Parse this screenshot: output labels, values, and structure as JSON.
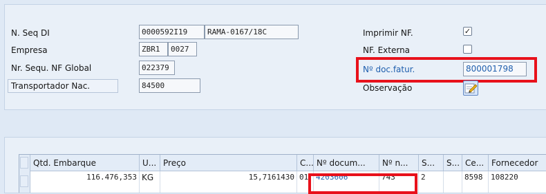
{
  "header_form": {
    "seq_di_label": "N. Seq DI",
    "seq_di_value": "0000592I19",
    "seq_di_ref": "RAMA-0167/18C",
    "empresa_label": "Empresa",
    "empresa_value1": "ZBR1",
    "empresa_value2": "0027",
    "nf_global_label": "Nr. Sequ. NF Global",
    "nf_global_value": "022379",
    "transportador_label": "Transportador Nac.",
    "transportador_value": "84500",
    "imprimir_nf_label": "Imprimir NF.",
    "imprimir_nf_checked": "✓",
    "nf_externa_label": "NF. Externa",
    "nf_externa_checked": "",
    "doc_fatur_label": "Nº doc.fatur.",
    "doc_fatur_value": "800001798",
    "observacao_label": "Observação",
    "observacao_icon": "edit-note-icon"
  },
  "table": {
    "columns": [
      "Qtd. Embarque",
      "U...",
      "Preço",
      "C...",
      "Nº docum...",
      "Nº n...",
      "S...",
      "S...",
      "Ce...",
      "Fornecedor"
    ],
    "rows": [
      [
        "116.476,353",
        "KG",
        "15,7161430",
        "01",
        "4203606",
        "743",
        "2",
        "",
        "8598",
        "108220"
      ]
    ]
  },
  "colors": {
    "highlight_box": "#e8111b",
    "link_text": "#1f5fae",
    "panel_background": "#e9f0f8"
  }
}
